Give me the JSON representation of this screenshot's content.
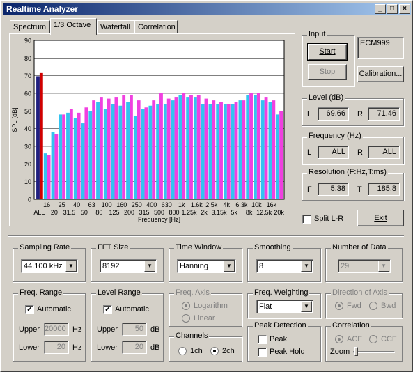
{
  "window": {
    "title": "Realtime Analyzer",
    "controls": [
      "_",
      "□",
      "×"
    ]
  },
  "tabs": [
    "Spectrum",
    "1/3 Octave",
    "Waterfall",
    "Correlation"
  ],
  "active_tab": 1,
  "chart_data": {
    "type": "bar",
    "ylabel": "SPL [dB]",
    "xlabel": "Frequency [Hz]",
    "ylim": [
      0,
      90
    ],
    "y_ticks": [
      0,
      10,
      20,
      30,
      40,
      50,
      60,
      70,
      80,
      90
    ],
    "categories": [
      "ALL",
      "16",
      "20",
      "25",
      "31.5",
      "40",
      "50",
      "63",
      "80",
      "100",
      "125",
      "160",
      "200",
      "250",
      "315",
      "400",
      "500",
      "630",
      "800",
      "1k",
      "1.25k",
      "1.6k",
      "2k",
      "2.5k",
      "3.15k",
      "4k",
      "5k",
      "6.3k",
      "8k",
      "10k",
      "12.5k",
      "16k",
      "20k"
    ],
    "x_labels_top": [
      "16",
      "25",
      "40",
      "63",
      "100",
      "160",
      "250",
      "400",
      "630",
      "1k",
      "1.6k",
      "2.5k",
      "4k",
      "6.3k",
      "10k",
      "16k"
    ],
    "x_labels_bottom": [
      "ALL",
      "20",
      "31.5",
      "50",
      "80",
      "125",
      "200",
      "315",
      "500",
      "800",
      "1.25k",
      "2k",
      "3.15k",
      "5k",
      "8k",
      "12.5k",
      "20k"
    ],
    "series": [
      {
        "name": "L",
        "color": "#33c3f0",
        "values": [
          69.7,
          26,
          38,
          48,
          49,
          46,
          43,
          50,
          55,
          51,
          54,
          53,
          55,
          47,
          51,
          53,
          54,
          54,
          56,
          59,
          58,
          58,
          54,
          54,
          54,
          54,
          54,
          56,
          59,
          59,
          56,
          55,
          48
        ]
      },
      {
        "name": "R",
        "color": "#f040e0",
        "values": [
          71.5,
          25,
          37,
          48,
          51,
          49,
          52,
          56,
          58,
          57,
          58,
          59,
          59,
          56,
          52,
          56,
          60,
          57,
          58,
          60,
          59,
          59,
          57,
          56,
          55,
          54,
          55,
          56,
          60,
          60,
          58,
          56,
          50
        ]
      }
    ],
    "all_colors": [
      "#202080",
      "#d00000"
    ],
    "grid": true
  },
  "input": {
    "label": "Input",
    "start": "Start",
    "stop": "Stop",
    "device": "ECM999",
    "calibration": "Calibration..."
  },
  "level": {
    "label": "Level (dB)",
    "l_label": "L",
    "l_value": "69.66",
    "r_label": "R",
    "r_value": "71.46"
  },
  "frequency": {
    "label": "Frequency (Hz)",
    "l_label": "L",
    "l_value": "ALL",
    "r_label": "R",
    "r_value": "ALL"
  },
  "resolution": {
    "label": "Resolution (F:Hz,T:ms)",
    "f_label": "F",
    "f_value": "5.38",
    "t_label": "T",
    "t_value": "185.8"
  },
  "split": {
    "label": "Split L-R",
    "checked": false
  },
  "exit": "Exit",
  "sampling_rate": {
    "label": "Sampling Rate",
    "value": "44.100 kHz"
  },
  "fft_size": {
    "label": "FFT Size",
    "value": "8192"
  },
  "time_window": {
    "label": "Time Window",
    "value": "Hanning"
  },
  "smoothing": {
    "label": "Smoothing",
    "value": "8"
  },
  "number_of_data": {
    "label": "Number of Data",
    "value": "29"
  },
  "freq_range": {
    "label": "Freq. Range",
    "automatic": "Automatic",
    "upper_label": "Upper",
    "upper_value": "20000",
    "upper_unit": "Hz",
    "lower_label": "Lower",
    "lower_value": "20",
    "lower_unit": "Hz"
  },
  "level_range": {
    "label": "Level Range",
    "automatic": "Automatic",
    "upper_label": "Upper",
    "upper_value": "50",
    "upper_unit": "dB",
    "lower_label": "Lower",
    "lower_value": "20",
    "lower_unit": "dB"
  },
  "freq_axis": {
    "label": "Freq. Axis",
    "log": "Logarithm",
    "linear": "Linear"
  },
  "channels": {
    "label": "Channels",
    "one": "1ch",
    "two": "2ch"
  },
  "freq_weighting": {
    "label": "Freq. Weighting",
    "value": "Flat"
  },
  "peak_detection": {
    "label": "Peak Detection",
    "peak": "Peak",
    "peak_hold": "Peak Hold"
  },
  "direction": {
    "label": "Direction of Axis",
    "fwd": "Fwd",
    "bwd": "Bwd"
  },
  "correlation": {
    "label": "Correlation",
    "acf": "ACF",
    "ccf": "CCF",
    "zoom": "Zoom"
  }
}
